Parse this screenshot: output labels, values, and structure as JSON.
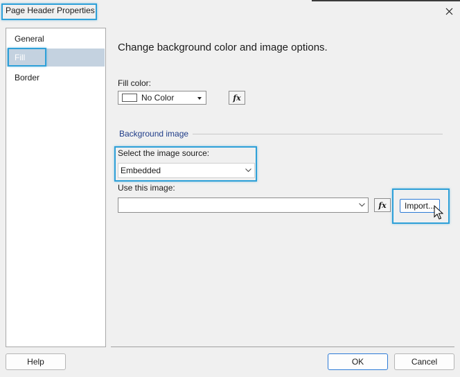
{
  "window": {
    "title": "Page Header Properties"
  },
  "nav": {
    "items": [
      {
        "label": "General",
        "selected": false
      },
      {
        "label": "Fill",
        "selected": true
      },
      {
        "label": "Border",
        "selected": false
      }
    ]
  },
  "fill": {
    "heading": "Change background color and image options.",
    "fill_color_label": "Fill color:",
    "fill_color_value": "No Color",
    "fx_label": "fx"
  },
  "background_image": {
    "section_title": "Background image",
    "source_label": "Select the image source:",
    "source_value": "Embedded",
    "image_label": "Use this image:",
    "image_value": "",
    "import_label": "Import..."
  },
  "buttons": {
    "help": "Help",
    "ok": "OK",
    "cancel": "Cancel"
  },
  "colors": {
    "accent": "#2c7ad6",
    "highlight": "#2ea0d8",
    "nav_selected": "#c4d2e0",
    "section_title": "#1f3c88"
  }
}
